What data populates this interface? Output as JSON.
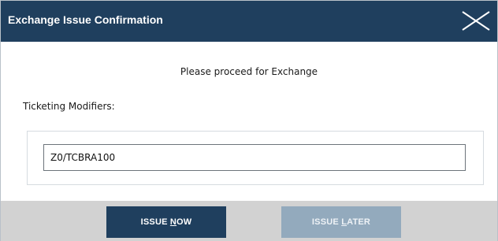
{
  "dialog": {
    "title": "Exchange Issue Confirmation",
    "close_icon": "close-icon"
  },
  "message": "Please proceed for Exchange",
  "ticketing": {
    "label": "Ticketing Modifiers:",
    "value": "Z0/TCBRA100"
  },
  "buttons": {
    "issue_now": {
      "prefix": "ISSUE ",
      "mnemonic": "N",
      "suffix": "OW"
    },
    "issue_later": {
      "prefix": "ISSUE ",
      "mnemonic": "L",
      "suffix": "ATER"
    }
  },
  "colors": {
    "titlebar": "#1f3f5e",
    "primary_button": "#1f3f5e",
    "disabled_button": "#93aabd",
    "footer": "#d2d2d2"
  }
}
